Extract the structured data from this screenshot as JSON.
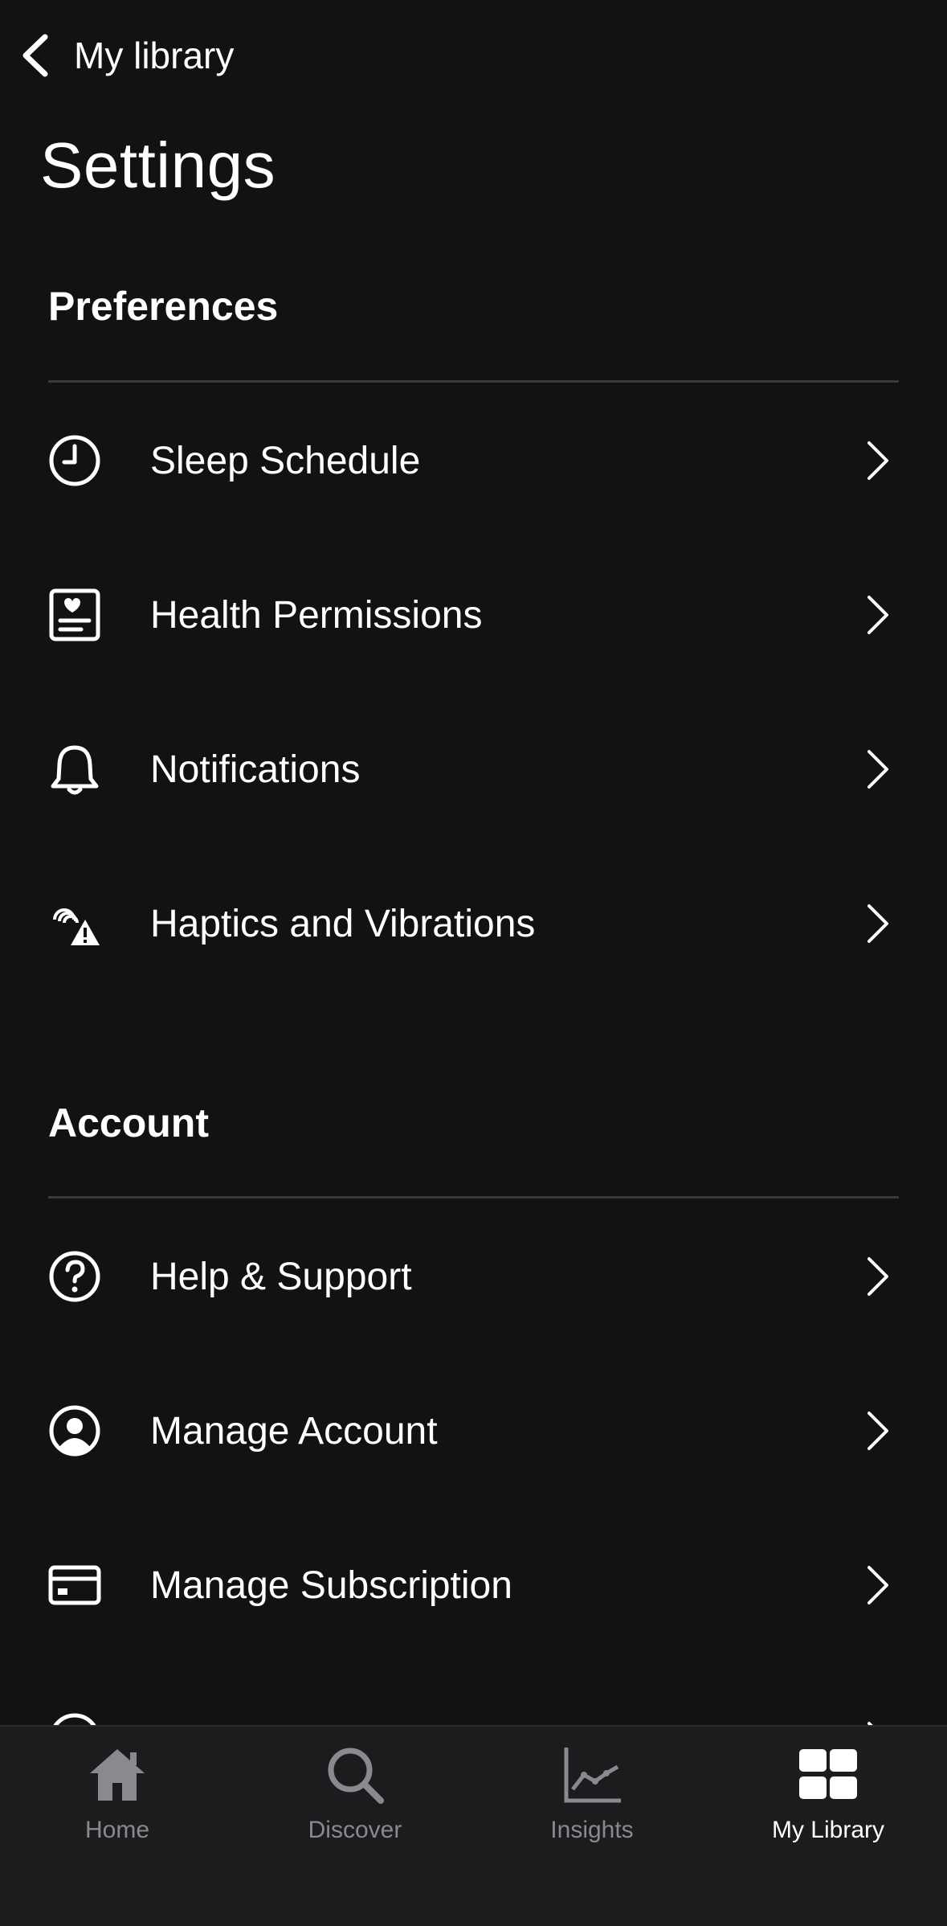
{
  "nav": {
    "back_label": "My library"
  },
  "title": "Settings",
  "sections": {
    "preferences": {
      "header": "Preferences",
      "items": [
        {
          "label": "Sleep Schedule",
          "icon": "clock-icon"
        },
        {
          "label": "Health Permissions",
          "icon": "health-card-icon"
        },
        {
          "label": "Notifications",
          "icon": "bell-icon"
        },
        {
          "label": "Haptics and Vibrations",
          "icon": "haptics-icon"
        }
      ]
    },
    "account": {
      "header": "Account",
      "items": [
        {
          "label": "Help & Support",
          "icon": "help-icon"
        },
        {
          "label": "Manage Account",
          "icon": "user-icon"
        },
        {
          "label": "Manage Subscription",
          "icon": "credit-card-icon"
        }
      ]
    }
  },
  "tabs": [
    {
      "label": "Home",
      "icon": "home-icon",
      "active": false
    },
    {
      "label": "Discover",
      "icon": "search-icon",
      "active": false
    },
    {
      "label": "Insights",
      "icon": "chart-icon",
      "active": false
    },
    {
      "label": "My Library",
      "icon": "grid-icon",
      "active": true
    }
  ],
  "colors": {
    "background": "#121212",
    "tab_bar": "#1c1c1e",
    "divider": "#3a3a3a",
    "text": "#ffffff",
    "inactive_tab": "#8a8a8e"
  }
}
